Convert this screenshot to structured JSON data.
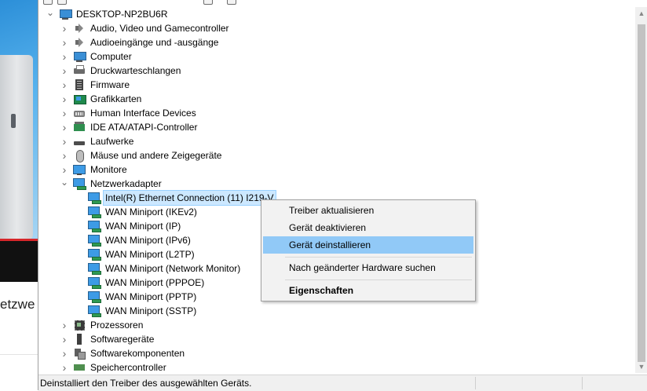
{
  "background_app": {
    "partial_text": "etzwe"
  },
  "tree": {
    "root": "DESKTOP-NP2BU6R",
    "categories": [
      "Audio, Video und Gamecontroller",
      "Audioeingänge und -ausgänge",
      "Computer",
      "Druckwarteschlangen",
      "Firmware",
      "Grafikkarten",
      "Human Interface Devices",
      "IDE ATA/ATAPI-Controller",
      "Laufwerke",
      "Mäuse und andere Zeigegeräte",
      "Monitore",
      "Netzwerkadapter"
    ],
    "network_adapters": [
      "Intel(R) Ethernet Connection (11) I219-V",
      "WAN Miniport (IKEv2)",
      "WAN Miniport (IP)",
      "WAN Miniport (IPv6)",
      "WAN Miniport (L2TP)",
      "WAN Miniport (Network Monitor)",
      "WAN Miniport (PPPOE)",
      "WAN Miniport (PPTP)",
      "WAN Miniport (SSTP)"
    ],
    "categories_after": [
      "Prozessoren",
      "Softwaregeräte",
      "Softwarekomponenten",
      "Speichercontroller"
    ]
  },
  "context_menu": {
    "items": [
      "Treiber aktualisieren",
      "Gerät deaktivieren",
      "Gerät deinstallieren",
      "Nach geänderter Hardware suchen",
      "Eigenschaften"
    ],
    "highlighted": "Gerät deinstallieren"
  },
  "status_bar": {
    "text": "Deinstalliert den Treiber des ausgewählten Geräts."
  },
  "colors": {
    "menu_highlight": "#91c9f7",
    "selection": "#cce8ff"
  },
  "icons": {
    "root": "computer-icon",
    "categories": [
      "audio-video-icon",
      "audio-io-icon",
      "computer-icon",
      "printer-icon",
      "firmware-icon",
      "display-adapter-icon",
      "hid-icon",
      "ide-controller-icon",
      "disk-drive-icon",
      "mouse-icon",
      "monitor-icon",
      "network-adapter-icon"
    ],
    "categories_after": [
      "processor-icon",
      "software-device-icon",
      "software-component-icon",
      "storage-controller-icon"
    ]
  }
}
